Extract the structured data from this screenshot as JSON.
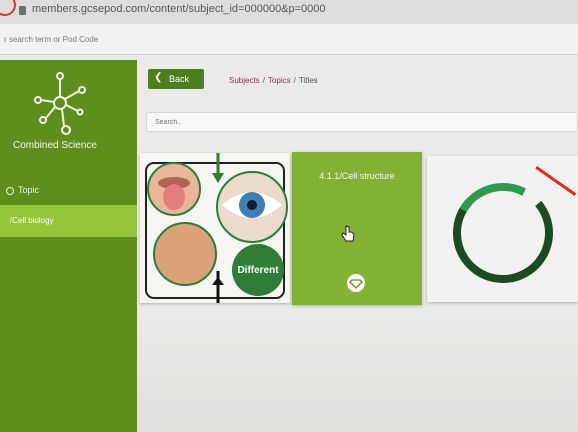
{
  "browser": {
    "url": "members.gcsepod.com/content/subject_id=000000&p=0000",
    "search_placeholder": "r search term or Pod Code"
  },
  "sidebar": {
    "brand": "Combined Science",
    "items": [
      {
        "label": "Topic"
      },
      {
        "label": "/Cell biology"
      }
    ]
  },
  "content": {
    "back_label": "Back",
    "breadcrumb": {
      "subjects": "Subjects",
      "topics": "Topics",
      "titles": "Titles",
      "sep": "/"
    },
    "search_placeholder": "Search..",
    "tiles": [
      {
        "badge": "Different"
      },
      {
        "title": "4.1.1/Cell structure"
      }
    ]
  },
  "colors": {
    "sidebar": "#5e8f1e",
    "active_item": "#94c53a",
    "back_button": "#4b7f1c",
    "tile_green": "#82b232",
    "breadcrumb_link": "#a3264f"
  },
  "icons": [
    "molecule-logo-icon",
    "back-chevron-icon",
    "hand-cursor-icon",
    "diamond-icon",
    "progress-ring-icon"
  ]
}
